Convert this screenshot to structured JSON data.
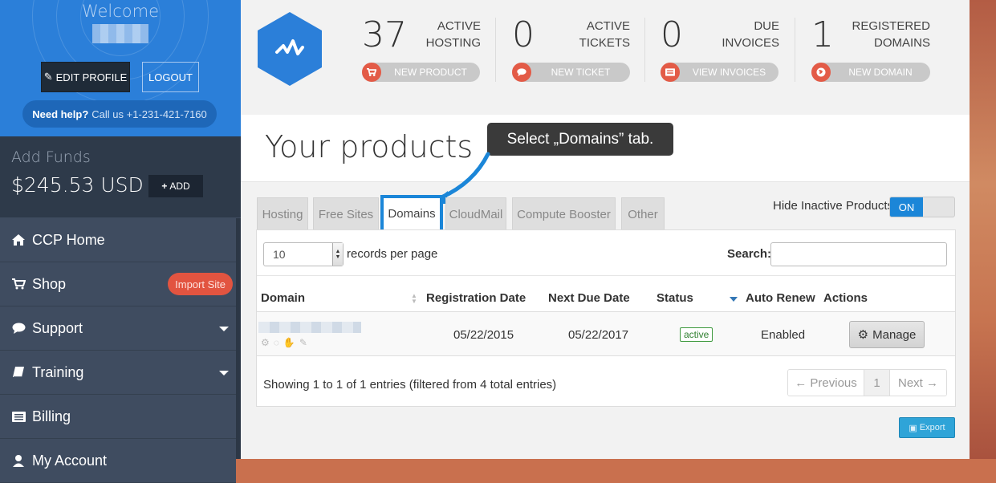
{
  "sidebar": {
    "welcome": "Welcome",
    "edit_profile": "EDIT PROFILE",
    "logout": "LOGOUT",
    "help_bold": "Need help?",
    "help_text": "Call us +1-231-421-7160",
    "funds_label": "Add Funds",
    "funds_amount": "$245.53 USD",
    "add_label": "ADD",
    "nav": [
      {
        "label": "CCP Home",
        "icon": "home-icon"
      },
      {
        "label": "Shop",
        "icon": "cart-icon",
        "badge": "Import Site"
      },
      {
        "label": "Support",
        "icon": "comment-icon"
      },
      {
        "label": "Training",
        "icon": "book-icon"
      },
      {
        "label": "Billing",
        "icon": "list-icon"
      },
      {
        "label": "My Account",
        "icon": "user-icon"
      }
    ]
  },
  "stats": [
    {
      "value": "37",
      "label1": "ACTIVE",
      "label2": "HOSTING",
      "action": "NEW PRODUCT",
      "icon": "cart-icon"
    },
    {
      "value": "0",
      "label1": "ACTIVE",
      "label2": "TICKETS",
      "action": "NEW TICKET",
      "icon": "comment-icon"
    },
    {
      "value": "0",
      "label1": "DUE",
      "label2": "INVOICES",
      "action": "VIEW INVOICES",
      "icon": "list-icon"
    },
    {
      "value": "1",
      "label1": "REGISTERED",
      "label2": "DOMAINS",
      "action": "NEW DOMAIN",
      "icon": "globe-icon"
    }
  ],
  "page": {
    "title": "Your products",
    "tooltip": "Select „Domains” tab."
  },
  "tabs": [
    "Hosting",
    "Free Sites",
    "Domains",
    "CloudMail",
    "Compute Booster",
    "Other"
  ],
  "active_tab": "Domains",
  "hide_inactive": "Hide Inactive Products",
  "toggle_on": "ON",
  "table": {
    "records_value": "10",
    "records_label": "records per page",
    "search_label": "Search:",
    "headers": [
      "Domain",
      "Registration Date",
      "Next Due Date",
      "Status",
      "Auto Renew",
      "Actions"
    ],
    "rows": [
      {
        "registration": "05/22/2015",
        "next_due": "05/22/2017",
        "status": "active",
        "auto_renew": "Enabled",
        "action": "Manage"
      }
    ],
    "showing": "Showing 1 to 1 of 1 entries (filtered from 4 total entries)",
    "prev": "← Previous",
    "page": "1",
    "next": "Next →",
    "export": "Export"
  },
  "colors": {
    "sidebar_blue": "#2b7fd9",
    "accent_red": "#e35b47",
    "highlight_blue": "#1b86d8"
  }
}
